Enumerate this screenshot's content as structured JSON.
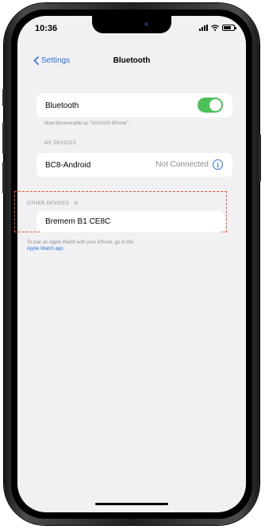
{
  "status_bar": {
    "time": "10:36"
  },
  "nav": {
    "back_label": "Settings",
    "title": "Bluetooth"
  },
  "bluetooth": {
    "label": "Bluetooth",
    "enabled": true,
    "discoverable_note": "Now discoverable as \"XXXXXX iPhone\"."
  },
  "my_devices": {
    "header": "MY DEVICES",
    "items": [
      {
        "name": "BC8-Android",
        "status": "Not Connected"
      }
    ]
  },
  "other_devices": {
    "header": "OTHER DEVICES",
    "items": [
      {
        "name": "Bremem B1 CE8C"
      }
    ]
  },
  "watch_note": {
    "text": "To pair an Apple Watch with your iPhone, go to the",
    "link": "Apple Watch app."
  },
  "colors": {
    "accent": "#2f6fd6",
    "toggle_on": "#4cc15a",
    "highlight_border": "#e55a2b"
  },
  "icons": [
    "chevron-left-icon",
    "info-icon",
    "spinner-icon",
    "signal-icon",
    "wifi-icon",
    "battery-icon"
  ]
}
